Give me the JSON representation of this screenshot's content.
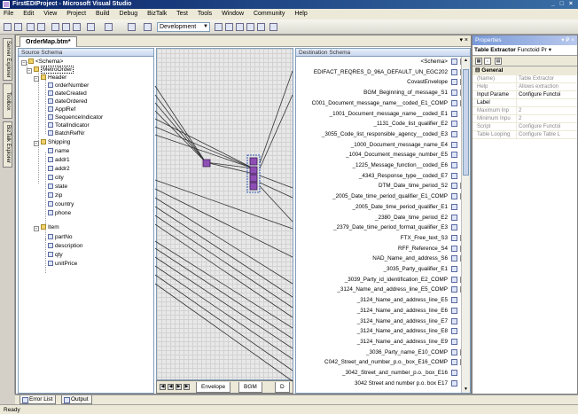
{
  "window": {
    "title": "FirstEDIProject - Microsoft Visual Studio",
    "controls": "_ □ ×"
  },
  "menu": [
    "File",
    "Edit",
    "View",
    "Project",
    "Build",
    "Debug",
    "BizTalk",
    "Test",
    "Tools",
    "Window",
    "Community",
    "Help"
  ],
  "toolbar": {
    "config_value": "Development"
  },
  "side_tabs": [
    "Server Explorer",
    "Toolbox",
    "BizTalk Explorer"
  ],
  "document": {
    "tab_label": "OrderMap.btm*",
    "tab_controls": "▾ ×"
  },
  "source": {
    "header": "Source Schema",
    "items": [
      "<Schema>",
      "MetroOrder",
      "Header",
      "orderNumber",
      "dateCreated",
      "dateOrdered",
      "ApplRef",
      "SequenceIndicator",
      "TotalIndicator",
      "BatchRefNr",
      "Shipping",
      "name",
      "addr1",
      "addr2",
      "city",
      "state",
      "zip",
      "country",
      "phone",
      "Item",
      "partNo",
      "description",
      "qty",
      "unitPrice"
    ]
  },
  "grid_tabs": [
    "Envelope",
    "BGM",
    "D"
  ],
  "destination": {
    "header": "Destination Schema",
    "rows": [
      "<Schema>",
      "EDIFACT_REQRES_D_96A_DEFAULT_UN_EGC202",
      "CovastEnvelope",
      "BGM_Beginning_of_message_S1",
      "C001_Document_message_name__coded_E1_COMP",
      "_1001_Document_message_name__coded_E1",
      "_1131_Code_list_qualifier_E2",
      "_3055_Code_list_responsible_agency__coded_E3",
      "_1000_Document_message_name_E4",
      "_1004_Document_message_number_E5",
      "_1225_Message_function__coded_E6",
      "_4343_Response_type__coded_E7",
      "DTM_Date_time_period_S2",
      "_2005_Date_time_period_qualifier_E1_COMP",
      "_2005_Date_time_period_qualifier_E1",
      "_2380_Date_time_period_E2",
      "_2379_Date_time_period_format_qualifier_E3",
      "FTX_Free_text_S3",
      "RFF_Reference_S4",
      "NAD_Name_and_address_S6",
      "_3035_Party_qualifier_E1",
      "_3039_Party_id_identification_E2_COMP",
      "_3124_Name_and_address_line_E5_COMP",
      "_3124_Name_and_address_line_E5",
      "_3124_Name_and_address_line_E6",
      "_3124_Name_and_address_line_E7",
      "_3124_Name_and_address_line_E8",
      "_3124_Name_and_address_line_E9",
      "_3036_Party_name_E10_COMP",
      "C042_Street_and_number_p.o._box_E16_COMP",
      "_3042_Street_and_number_p.o._box_E16",
      "3042 Street and number p.o. box E17"
    ]
  },
  "properties": {
    "title": "Properties",
    "title_controls": "▾ ₽ ×",
    "object_name": "Table Extractor",
    "object_type": "Functoid Pr",
    "category": "General",
    "rows": [
      {
        "name": "(Name)",
        "value": "Table Extractor",
        "readonly": true
      },
      {
        "name": "Help",
        "value": "Allows extraction",
        "readonly": true
      },
      {
        "name": "Input Parame",
        "value": "Configure Functoi",
        "readonly": false
      },
      {
        "name": "Label",
        "value": "",
        "readonly": false
      },
      {
        "name": "Maximum Inp",
        "value": "2",
        "readonly": true
      },
      {
        "name": "Minimum Inpu",
        "value": "2",
        "readonly": true
      },
      {
        "name": "Script",
        "value": "Configure Functoi",
        "readonly": true
      },
      {
        "name": "Table Looping",
        "value": "Configure Table L",
        "readonly": true
      }
    ]
  },
  "bottom_tabs": [
    "Error List",
    "Output"
  ],
  "status": "Ready"
}
